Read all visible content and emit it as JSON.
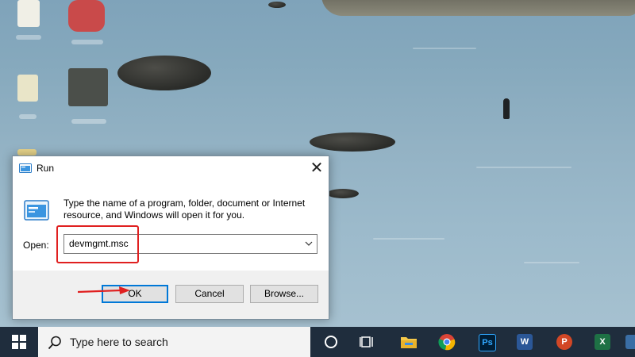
{
  "run_dialog": {
    "title": "Run",
    "description": "Type the name of a program, folder, document or Internet resource, and Windows will open it for you.",
    "open_label": "Open:",
    "open_value": "devmgmt.msc",
    "buttons": {
      "ok": "OK",
      "cancel": "Cancel",
      "browse": "Browse..."
    },
    "close_glyph": "✕"
  },
  "taskbar": {
    "search_placeholder": "Type here to search",
    "apps": [
      {
        "name": "cortana-icon"
      },
      {
        "name": "task-view-icon"
      },
      {
        "name": "file-explorer-icon"
      },
      {
        "name": "chrome-icon"
      },
      {
        "name": "photoshop-icon",
        "text": "Ps"
      },
      {
        "name": "word-icon",
        "text": "W"
      },
      {
        "name": "powerpoint-icon",
        "text": "P"
      },
      {
        "name": "excel-icon",
        "text": "X"
      }
    ]
  },
  "colors": {
    "accent": "#0078d7",
    "annotation_red": "#e02020",
    "taskbar": "#1f2d3d"
  }
}
